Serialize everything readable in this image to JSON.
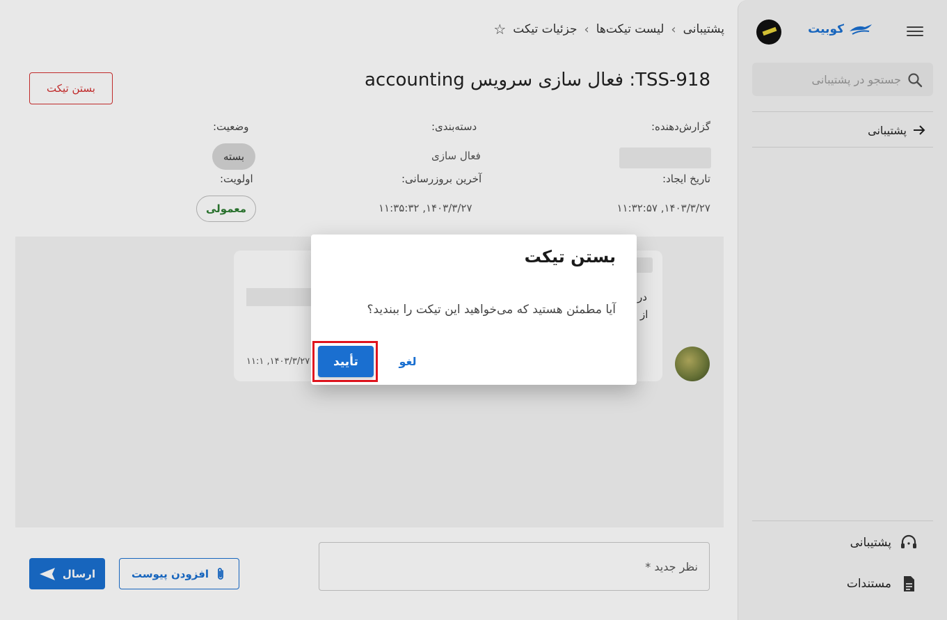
{
  "sidebar": {
    "brand_name": "کوبیت",
    "search_placeholder": "جستجو در پشتیبانی",
    "nav_back_label": "پشتیبانی",
    "bottom_items": [
      {
        "label": "پشتیبانی",
        "icon": "headset-icon"
      },
      {
        "label": "مستندات",
        "icon": "document-icon"
      }
    ]
  },
  "breadcrumb": {
    "items": [
      "پشتیبانی",
      "لیست تیکت‌ها",
      "جزئیات تیکت"
    ],
    "star_icon": "star-icon"
  },
  "ticket": {
    "title": "TSS-918: فعال سازی سرویس accounting",
    "close_button": "بستن تیکت",
    "fields": {
      "reporter_label": "گزارش‌دهنده:",
      "category_label": "دسته‌بندی:",
      "category_value": "فعال سازی",
      "status_label": "وضعیت:",
      "status_value": "بسته",
      "created_label": "تاریخ ایجاد:",
      "created_value": "۱۴۰۳/۳/۲۷, ۱۱:۳۲:۵۷",
      "updated_label": "آخرین بروزرسانی:",
      "updated_value": "۱۴۰۳/۳/۲۷, ۱۱:۳۵:۳۲",
      "priority_label": "اولویت:",
      "priority_value": "معمولی"
    }
  },
  "comment": {
    "text_line1": "در",
    "text_line2": "از",
    "date": "۱۴۰۳/۳/۲۷, ۱۱:۱"
  },
  "composer": {
    "placeholder": "نظر جدید *",
    "attach_label": "افزودن پیوست",
    "send_label": "ارسال"
  },
  "dialog": {
    "title": "بستن تیکت",
    "message": "آیا مطمئن هستید که می‌خواهید این تیکت را ببندید؟",
    "confirm_label": "تأیید",
    "cancel_label": "لغو"
  },
  "colors": {
    "primary": "#1a6fd0",
    "danger": "#d32f2f",
    "highlight": "#e0141e",
    "priority_text": "#2e7d32"
  }
}
